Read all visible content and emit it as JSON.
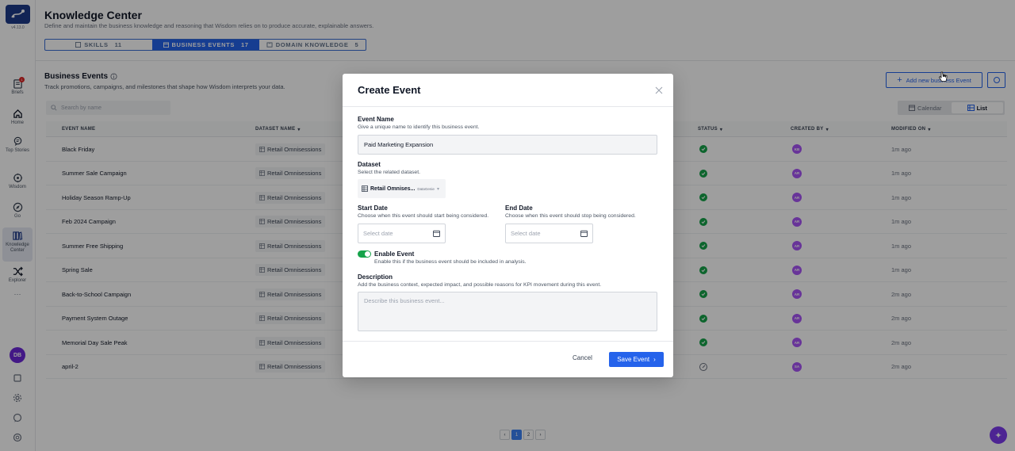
{
  "app": {
    "version": "v4.13.0"
  },
  "sidebar": {
    "items": [
      {
        "label": "Briefs",
        "icon": "briefs-icon",
        "badge": "1"
      },
      {
        "label": "Home",
        "icon": "home-icon"
      },
      {
        "label": "Top Stories",
        "icon": "top-stories-icon"
      },
      {
        "label": "Wisdom",
        "icon": "wisdom-icon"
      },
      {
        "label": "Go",
        "icon": "compass-icon"
      },
      {
        "label": "Knowledge Center",
        "icon": "knowledge-icon",
        "active": true
      },
      {
        "label": "Explorer",
        "icon": "explorer-icon"
      }
    ],
    "more": "···",
    "avatar": "DB"
  },
  "header": {
    "title": "Knowledge Center",
    "subtitle": "Define and maintain the business knowledge and reasoning that Wisdom relies on to produce accurate, explainable answers.",
    "tabs": [
      {
        "label": "SKILLS",
        "count": "11"
      },
      {
        "label": "BUSINESS EVENTS",
        "count": "17",
        "active": true
      },
      {
        "label": "DOMAIN KNOWLEDGE",
        "count": "5"
      }
    ]
  },
  "section": {
    "title": "Business Events",
    "subtitle": "Track promotions, campaigns, and milestones that shape how Wisdom interprets your data.",
    "add_button": "Add new business Event",
    "search_placeholder": "Search by name",
    "views": {
      "calendar": "Calendar",
      "list": "List"
    }
  },
  "table": {
    "columns": {
      "name": "EVENT NAME",
      "dataset": "DATASET NAME",
      "status": "STATUS",
      "created_by": "CREATED BY",
      "modified": "MODIFIED ON"
    },
    "rows": [
      {
        "name": "Black Friday",
        "dataset": "Retail Omnisessions",
        "status": "enabled",
        "creator": "KB",
        "modified": "1m ago"
      },
      {
        "name": "Summer Sale Campaign",
        "dataset": "Retail Omnisessions",
        "status": "enabled",
        "creator": "AR",
        "modified": "1m ago"
      },
      {
        "name": "Holiday Season Ramp-Up",
        "dataset": "Retail Omnisessions",
        "status": "enabled",
        "creator": "AR",
        "modified": "1m ago"
      },
      {
        "name": "Feb 2024 Campaign",
        "dataset": "Retail Omnisessions",
        "status": "enabled",
        "creator": "AR",
        "modified": "1m ago"
      },
      {
        "name": "Summer Free Shipping",
        "dataset": "Retail Omnisessions",
        "status": "enabled",
        "creator": "AR",
        "modified": "1m ago"
      },
      {
        "name": "Spring Sale",
        "dataset": "Retail Omnisessions",
        "status": "enabled",
        "creator": "AR",
        "modified": "1m ago"
      },
      {
        "name": "Back-to-School Campaign",
        "dataset": "Retail Omnisessions",
        "status": "enabled",
        "creator": "AR",
        "modified": "2m ago"
      },
      {
        "name": "Payment System Outage",
        "dataset": "Retail Omnisessions",
        "status": "enabled",
        "creator": "AR",
        "modified": "2m ago"
      },
      {
        "name": "Memorial Day Sale Peak",
        "dataset": "Retail Omnisessions",
        "status": "enabled",
        "creator": "AR",
        "modified": "2m ago"
      },
      {
        "name": "april-2",
        "dataset": "Retail Omnisessions",
        "status": "disabled",
        "creator": "SA",
        "modified": "2m ago"
      }
    ]
  },
  "pagination": {
    "pages": [
      "1",
      "2"
    ],
    "current": "1",
    "prev": "‹",
    "next": "›"
  },
  "modal": {
    "title": "Create Event",
    "event_name": {
      "label": "Event Name",
      "help": "Give a unique name to identify this business event.",
      "value": "Paid Marketing Expansion"
    },
    "dataset": {
      "label": "Dataset",
      "help": "Select the related dataset.",
      "value": "Retail Omnises...",
      "tag": "DataGenie"
    },
    "start_date": {
      "label": "Start Date",
      "help": "Choose when this event should start being considered.",
      "placeholder": "Select date"
    },
    "end_date": {
      "label": "End Date",
      "help": "Choose when this event should stop being considered.",
      "placeholder": "Select date"
    },
    "enable": {
      "label": "Enable Event",
      "help": "Enable this if the business event should be included in analysis.",
      "on": true
    },
    "description": {
      "label": "Description",
      "help": "Add the business context, expected impact, and possible reasons for KPI movement during this event.",
      "placeholder": "Describe this business event..."
    },
    "cancel": "Cancel",
    "save": "Save Event"
  },
  "colors": {
    "primary": "#2563eb",
    "success": "#16a34a",
    "avatar": "#a855f7",
    "brand": "#1e3a8a"
  }
}
